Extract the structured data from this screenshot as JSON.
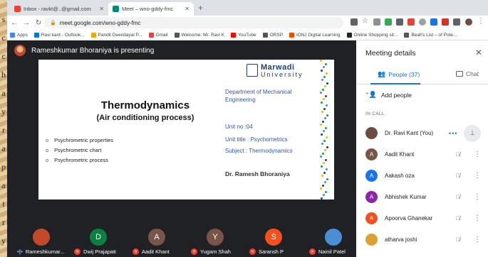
{
  "browser": {
    "tabs": [
      {
        "title": "Inbox - ravkt@..@gmail.com",
        "favicon_color": "#ea4335"
      },
      {
        "title": "Meet – wno-gddy-fmc",
        "favicon_color": "#00897b"
      }
    ],
    "url": "meet.google.com/wno-gddy-fmc",
    "bookmarks": [
      {
        "label": "Apps",
        "icon_color": "#4285f4"
      },
      {
        "label": "Ravi kant - Outlook...",
        "icon_color": "#0078d4"
      },
      {
        "label": "Pandit Deendayal P...",
        "icon_color": "#f4a300"
      },
      {
        "label": "Gmail",
        "icon_color": "#ea4335"
      },
      {
        "label": "Welcome: Mr. Ravi K",
        "icon_color": "#555555"
      },
      {
        "label": "YouTube",
        "icon_color": "#ff0000"
      },
      {
        "label": "ORSP",
        "icon_color": "#555555"
      },
      {
        "label": "iONJ Digital Learning",
        "icon_color": "#e65100"
      },
      {
        "label": "Online Shopping sit...",
        "icon_color": "#222222"
      },
      {
        "label": "Beall's List – of Pote...",
        "icon_color": "#555555"
      }
    ]
  },
  "meeting": {
    "presenter_banner": "Rameshkumar Bhoraniya is presenting",
    "slide": {
      "logo_name": "Marwadi",
      "logo_sub": "University",
      "title": "Thermodynamics",
      "subtitle": "(Air conditioning process)",
      "department": "Department of Mechanical Engineering",
      "unit_no": "Unit no :04",
      "unit_title": "Unit title : Psychometrics",
      "subject": "Subject : Thermodynamics",
      "author": "Dr. Ramesh Bhoraniya",
      "bullets": [
        "Psychrometric properties",
        "Psychrometric  chart",
        "Psychrometric process"
      ]
    },
    "participants": [
      {
        "name": "Rameshkumar...",
        "initial": "",
        "color": "#c24a2a",
        "speaking": true
      },
      {
        "name": "Dwij Prajapati",
        "initial": "D",
        "color": "#0b8043",
        "speaking": false
      },
      {
        "name": "Aadit Khant",
        "initial": "A",
        "color": "#795548",
        "speaking": false
      },
      {
        "name": "Yugam Shah",
        "initial": "Y",
        "color": "#795548",
        "speaking": false
      },
      {
        "name": "Saransh P",
        "initial": "S",
        "color": "#f4511e",
        "speaking": false
      },
      {
        "name": "Nainil Patel",
        "initial": "",
        "color": "#4a8fd6",
        "speaking": false
      }
    ]
  },
  "panel": {
    "title": "Meeting details",
    "people_tab": "People (37)",
    "chat_tab": "Chat",
    "add_people": "Add people",
    "in_call_label": "IN CALL",
    "people": [
      {
        "name": "Dr. Ravi Kant (You)",
        "initial": "",
        "color": "#6d4c41",
        "is_you": true
      },
      {
        "name": "Aadit Khant",
        "initial": "A",
        "color": "#795548",
        "is_you": false
      },
      {
        "name": "Aakash oza",
        "initial": "A",
        "color": "#1a73e8",
        "is_you": false
      },
      {
        "name": "Abhishek Kumar",
        "initial": "A",
        "color": "#8e24aa",
        "is_you": false
      },
      {
        "name": "Apoorva Ghanekar",
        "initial": "A",
        "color": "#f4511e",
        "is_you": false
      },
      {
        "name": "atharva joshi",
        "initial": "",
        "color": "#e0a030",
        "is_you": false
      }
    ]
  },
  "side_text": [
    "s",
    "c",
    "c",
    "h",
    "a",
    "y",
    "r",
    "a",
    "p",
    "a",
    "t",
    "r",
    "y"
  ]
}
